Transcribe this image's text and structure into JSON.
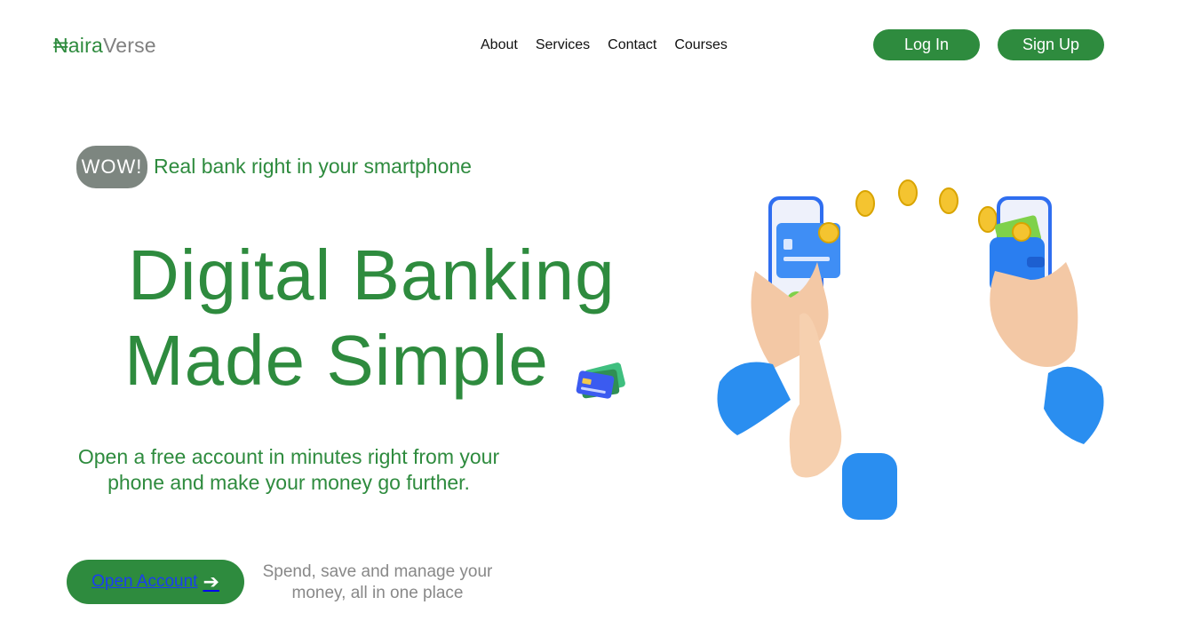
{
  "logo": {
    "part1": "₦aira",
    "part2": "Verse"
  },
  "nav": {
    "items": [
      "About",
      "Services",
      "Contact",
      "Courses"
    ]
  },
  "auth": {
    "login": "Log In",
    "signup": "Sign Up"
  },
  "hero": {
    "badge": "WOW!",
    "tagline": "Real bank right in your smartphone",
    "headline_line1": "Digital Banking",
    "headline_line2": "Made Simple",
    "description": "Open a free account in minutes right from your phone and make your money go further.",
    "cta_label": "Open Account",
    "subtext": "Spend, save and manage your money, all in one place"
  },
  "colors": {
    "brand": "#2e8b3e",
    "badge": "#7d8680",
    "muted": "#808080"
  },
  "icons": [
    "card-money-icon",
    "arrow-right-icon",
    "phone-payment-illustration"
  ]
}
